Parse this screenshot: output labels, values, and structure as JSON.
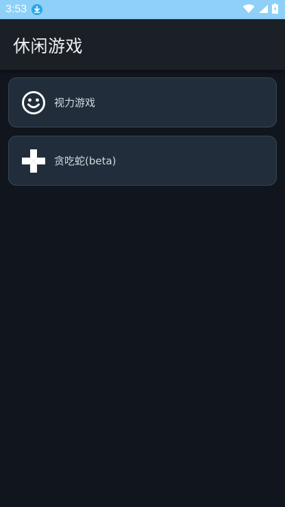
{
  "status_bar": {
    "time": "3:53",
    "icons": [
      "download-icon",
      "wifi-icon",
      "signal-icon",
      "battery-icon"
    ],
    "background_color": "#8ed0f7"
  },
  "app_bar": {
    "title": "休闲游戏"
  },
  "games": [
    {
      "label": "视力游戏",
      "icon": "smiley-face-icon"
    },
    {
      "label": "贪吃蛇(beta)",
      "icon": "gamepad-dpad-icon"
    }
  ],
  "colors": {
    "background": "#10151e",
    "app_bar": "#1b1f26",
    "card": "#212d3a",
    "card_border": "#3a4655",
    "text": "#d3dae2"
  }
}
